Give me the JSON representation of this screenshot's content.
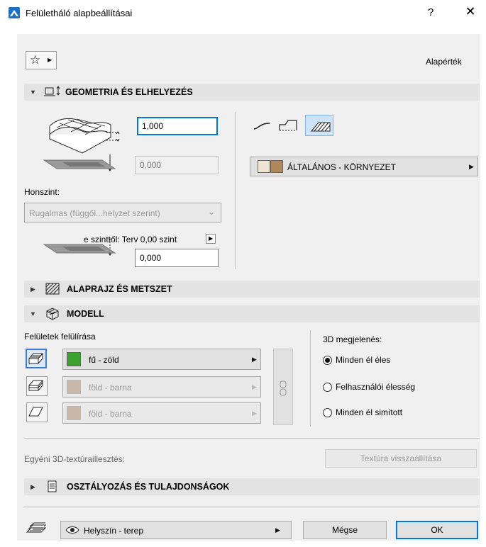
{
  "window": {
    "title": "Felületháló alapbeállításai",
    "help": "?",
    "close": "✕"
  },
  "top": {
    "default_label": "Alapérték"
  },
  "geometry": {
    "section_title": "GEOMETRIA ÉS ELHELYEZÉS",
    "height_value": "1,000",
    "base_value": "0,000",
    "story_label": "Honszint:",
    "story_select": "Rugalmas (függől...helyzet szerint)",
    "offset_label": "e szinttől: Terv 0,00 szint",
    "offset_value": "0,000",
    "surface_material": "ÁLTALÁNOS - KÖRNYEZET"
  },
  "floorplan": {
    "section_title": "ALAPRAJZ ÉS METSZET"
  },
  "model": {
    "section_title": "MODELL",
    "overrides_label": "Felületek felülírása",
    "surfaces": [
      {
        "label": "fű - zöld",
        "color": "#3aa12e",
        "enabled": true
      },
      {
        "label": "föld - barna",
        "color": "#c9b8aa",
        "enabled": false
      },
      {
        "label": "föld - barna",
        "color": "#c9b8aa",
        "enabled": false
      }
    ],
    "view3d_label": "3D megjelenés:",
    "radios": [
      {
        "label": "Minden él éles",
        "checked": true
      },
      {
        "label": "Felhasználói élesség",
        "checked": false
      },
      {
        "label": "Minden él simított",
        "checked": false
      }
    ],
    "texture_label": "Egyéni 3D-textúraillesztés:",
    "texture_button": "Textúra visszaállítása"
  },
  "classification": {
    "section_title": "OSZTÁLYOZÁS ÉS TULAJDONSÁGOK"
  },
  "footer": {
    "layer": "Helyszín - terep",
    "cancel": "Mégse",
    "ok": "OK"
  },
  "colors": {
    "accent": "#0078d7",
    "material_a": "#efe4d4",
    "material_b": "#b08858"
  }
}
